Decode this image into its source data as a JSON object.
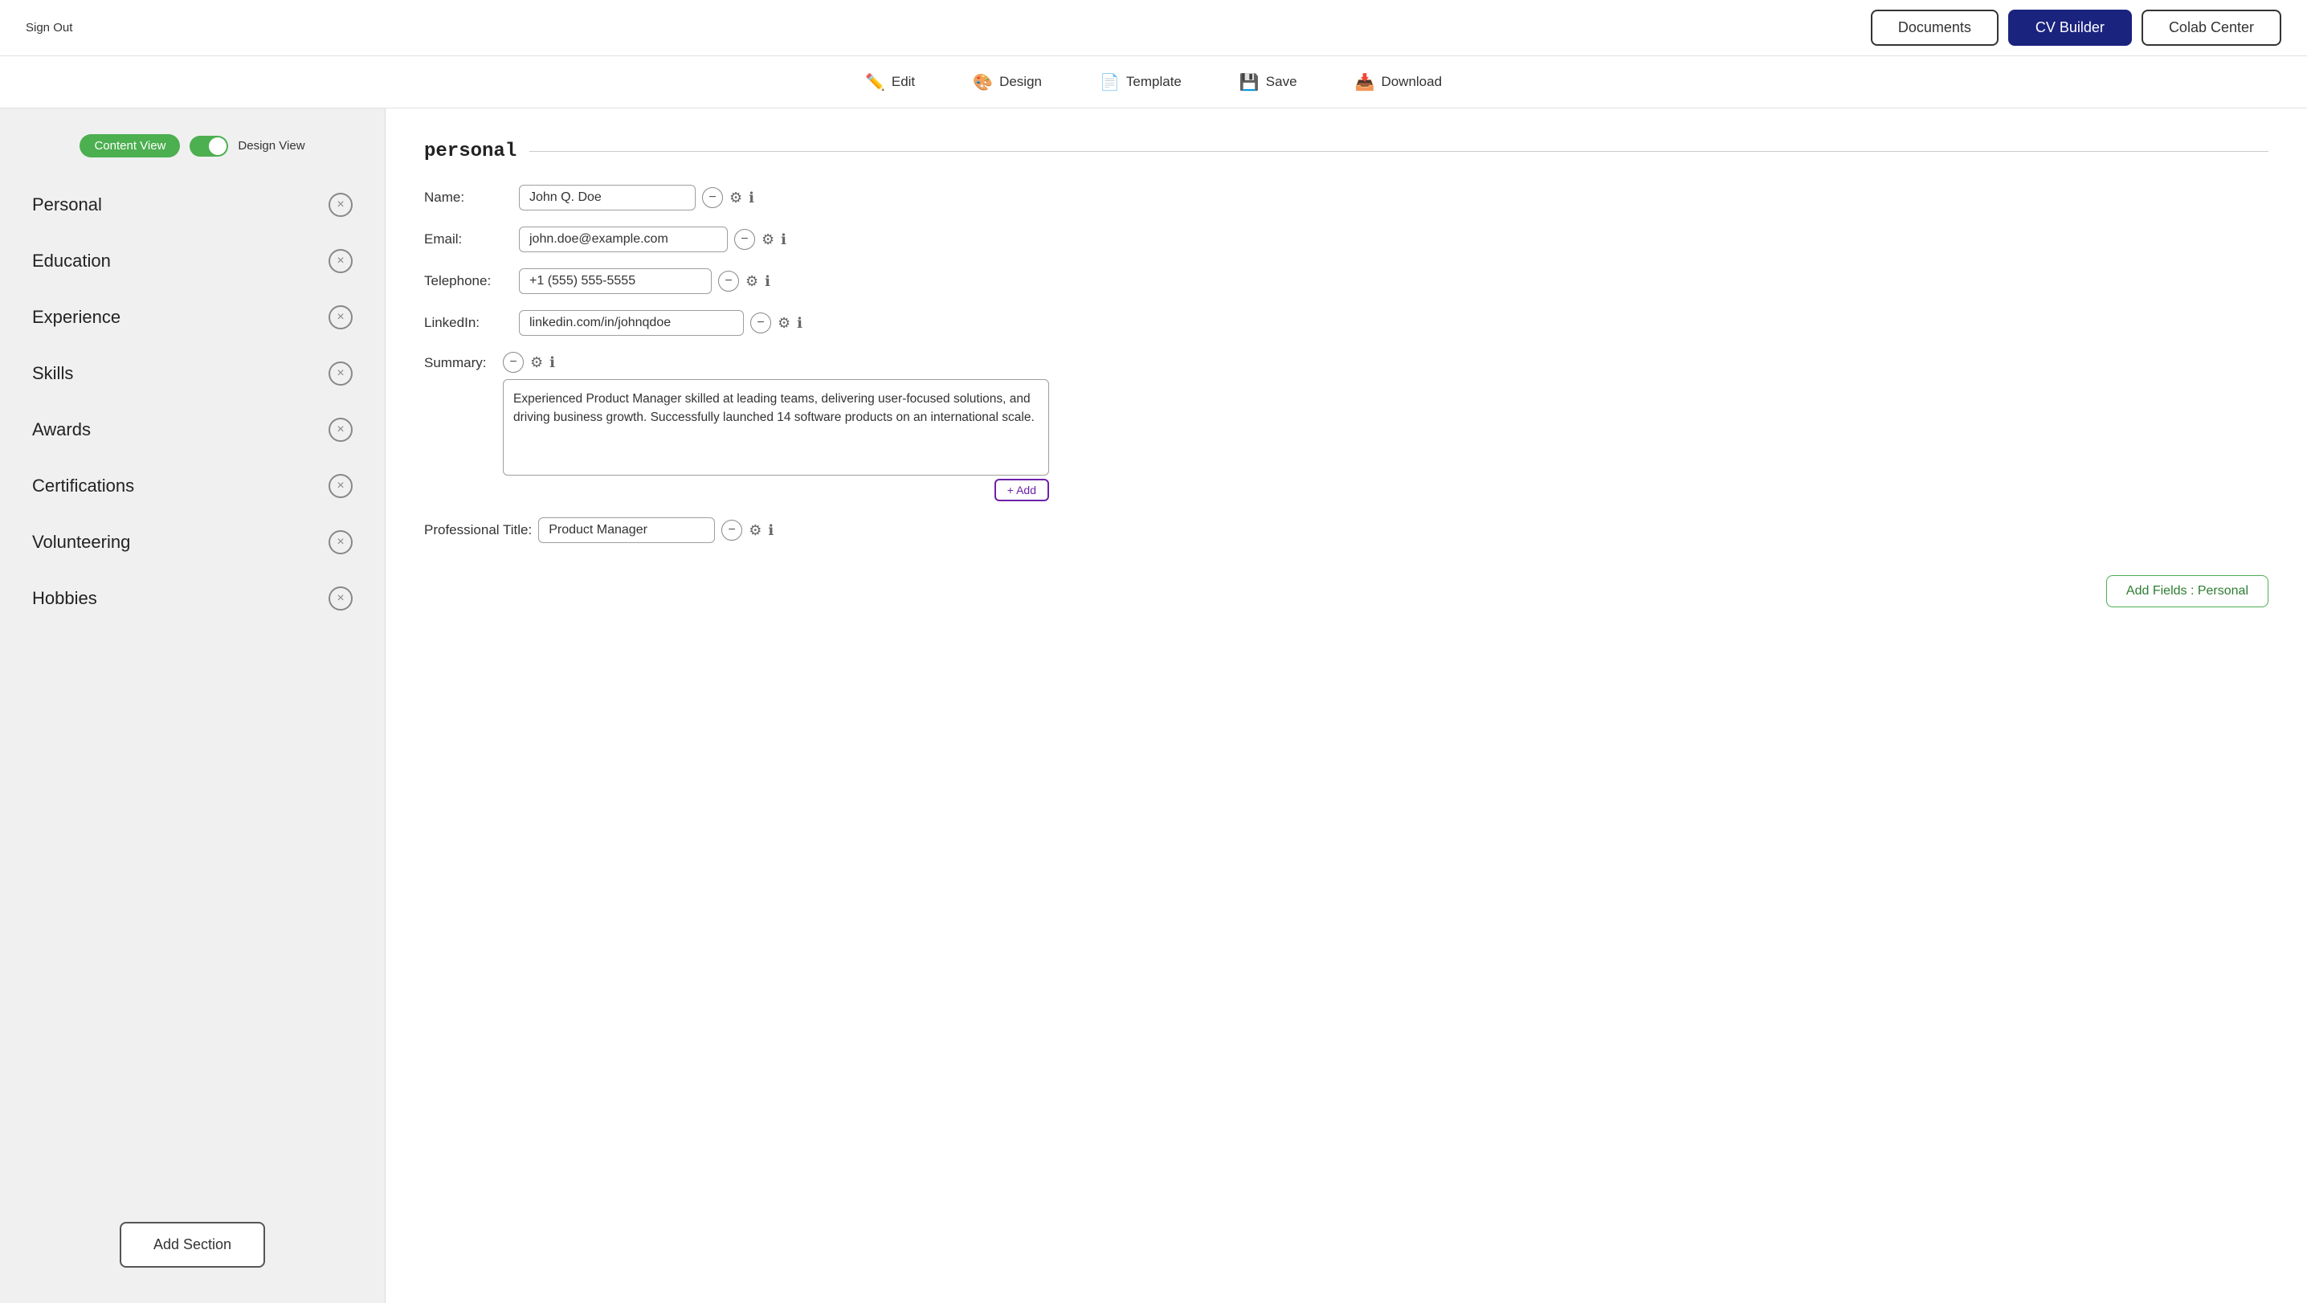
{
  "nav": {
    "sign_out": "Sign Out",
    "buttons": [
      {
        "label": "Documents",
        "active": false
      },
      {
        "label": "CV Builder",
        "active": true
      },
      {
        "label": "Colab Center",
        "active": false
      }
    ]
  },
  "toolbar": {
    "items": [
      {
        "label": "Edit",
        "icon": "✏️"
      },
      {
        "label": "Design",
        "icon": "🎨"
      },
      {
        "label": "Template",
        "icon": "📄"
      },
      {
        "label": "Save",
        "icon": "💾"
      },
      {
        "label": "Download",
        "icon": "📥"
      }
    ]
  },
  "sidebar": {
    "content_view_label": "Content View",
    "design_view_label": "Design View",
    "sections": [
      {
        "label": "Personal"
      },
      {
        "label": "Education"
      },
      {
        "label": "Experience"
      },
      {
        "label": "Skills"
      },
      {
        "label": "Awards"
      },
      {
        "label": "Certifications"
      },
      {
        "label": "Volunteering"
      },
      {
        "label": "Hobbies"
      }
    ],
    "add_section_label": "Add Section"
  },
  "content": {
    "section_title": "personal",
    "fields": {
      "name_label": "Name:",
      "name_value": "John Q. Doe",
      "email_label": "Email:",
      "email_value": "john.doe@example.com",
      "telephone_label": "Telephone:",
      "telephone_value": "+1 (555) 555-5555",
      "linkedin_label": "LinkedIn:",
      "linkedin_value": "linkedin.com/in/johnqdoe",
      "summary_label": "Summary:",
      "summary_value": "Experienced Product Manager skilled at leading teams, delivering user-focused solutions, and driving business growth. Successfully launched 14 software products on an international scale.",
      "professional_title_label": "Professional Title:",
      "professional_title_value": "Product Manager"
    },
    "plus_add_label": "+ Add",
    "add_fields_label": "Add Fields : Personal"
  }
}
